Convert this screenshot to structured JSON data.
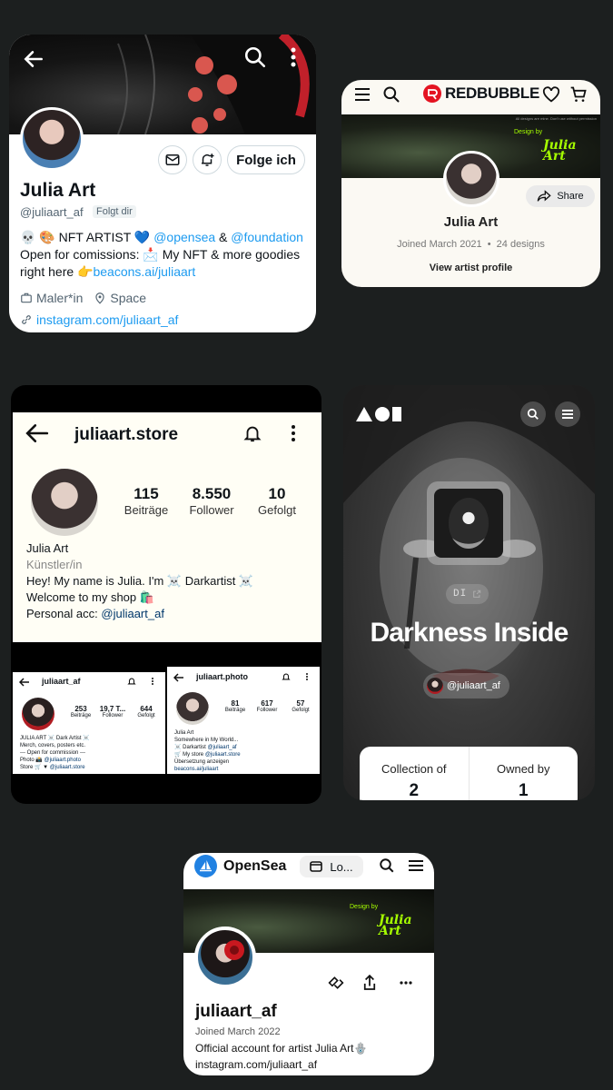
{
  "twitter": {
    "follow_label": "Folge ich",
    "name": "Julia Art",
    "handle": "@juliaart_af",
    "follows_you": "Folgt dir",
    "bio_line1_prefix": "💀 🎨 NFT ARTIST 💙 ",
    "bio_link_opensea": "@opensea",
    "bio_amp": " & ",
    "bio_link_foundation": "@foundation",
    "bio_line2": "Open for comissions: 📩 My NFT & more goodies",
    "bio_line3_prefix": "right here 👉",
    "bio_link_beacons": "beacons.ai/juliaart",
    "job": "Maler*in",
    "location": "Space",
    "website": "instagram.com/juliaart_af"
  },
  "redbubble": {
    "logo_text": "REDBUBBLE",
    "banner_note": "All designs are mine. Don't use without permission",
    "banner_design_by": "Design by",
    "banner_logo": "Julia Art",
    "share_label": "Share",
    "name": "Julia Art",
    "joined": "Joined March 2021",
    "dot": "•",
    "designs": "24 designs",
    "view_profile": "View artist profile"
  },
  "instagram": {
    "username": "juliaart.store",
    "stats": [
      {
        "value": "115",
        "label": "Beiträge"
      },
      {
        "value": "8.550",
        "label": "Follower"
      },
      {
        "value": "10",
        "label": "Gefolgt"
      }
    ],
    "name": "Julia Art",
    "category": "Künstler/in",
    "bio1": "Hey! My name is Julia. I'm ☠️ Darkartist ☠️",
    "bio2": "Welcome to my shop 🛍️",
    "bio3_prefix": "Personal acc: ",
    "bio3_link": "@juliaart_af",
    "mini1": {
      "username": "juliaart_af",
      "stats": [
        {
          "value": "253",
          "label": "Beiträge"
        },
        {
          "value": "19,7 T...",
          "label": "Follower"
        },
        {
          "value": "644",
          "label": "Gefolgt"
        }
      ],
      "bio1": "JULIA ART ☠️ Dark Artist ☠️",
      "bio2": "Merch, covers, posters etc.",
      "bio3": "--- Open for commission ---",
      "bio4_prefix": "Photo 📸 ",
      "bio4_link": "@juliaart.photo",
      "bio5_prefix": "Store 🛒 ▼ ",
      "bio5_link": "@juliaart.store"
    },
    "mini2": {
      "username": "juliaart.photo",
      "stats": [
        {
          "value": "81",
          "label": "Beiträge"
        },
        {
          "value": "617",
          "label": "Follower"
        },
        {
          "value": "57",
          "label": "Gefolgt"
        }
      ],
      "bio1": "Julia Art",
      "bio2": "Somewhere in My World...",
      "bio3_prefix": "☠️ Darkartist ",
      "bio3_link": "@juliaart_af",
      "bio4_prefix": "🛒 My store ",
      "bio4_link": "@juliaart.store",
      "bio5": "Übersetzung anzeigen",
      "bio6": "beacons.ai/juliaart"
    }
  },
  "foundation": {
    "initials": "DI",
    "title": "Darkness Inside",
    "creator": "@juliaart_af",
    "collection_label": "Collection of",
    "collection_value": "2",
    "owned_label": "Owned by",
    "owned_value": "1"
  },
  "opensea": {
    "brand": "OpenSea",
    "login_label": "Lo...",
    "banner_design_by": "Design by",
    "banner_logo": "Julia Art",
    "username": "juliaart_af",
    "joined": "Joined March 2022",
    "bio": "Official account for artist Julia Art🪬",
    "link": "instagram.com/juliaart_af"
  }
}
